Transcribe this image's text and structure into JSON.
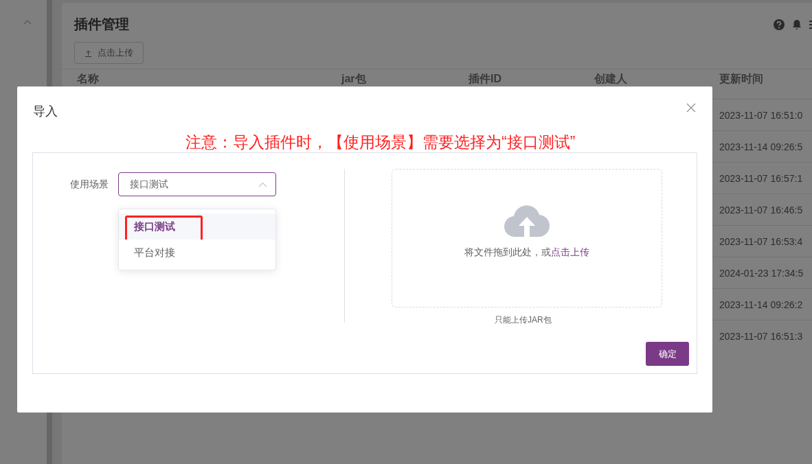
{
  "page": {
    "title": "插件管理",
    "upload_button": "点击上传"
  },
  "table": {
    "columns": [
      "名称",
      "jar包",
      "插件ID",
      "创建人",
      "更新时间"
    ],
    "rows": [
      {
        "updated": "2023-11-07 16:51:0"
      },
      {
        "updated": "2023-11-14 09:26:5"
      },
      {
        "updated": "2023-11-07 16:57:1"
      },
      {
        "updated": "2023-11-07 16:46:5"
      },
      {
        "updated": "2023-11-07 16:53:4"
      },
      {
        "updated": "2024-01-23 17:34:5"
      },
      {
        "updated": "2023-11-14 09:26:2"
      },
      {
        "updated": "2023-11-07 16:51:3"
      }
    ]
  },
  "dialog": {
    "title": "导入",
    "annotation": "注意：导入插件时，【使用场景】需要选择为“接口测试”",
    "field_label": "使用场景",
    "select": {
      "value": "接口测试",
      "expanded": true
    },
    "options": [
      {
        "label": "接口测试",
        "selected": true,
        "highlighted": true
      },
      {
        "label": "平台对接",
        "selected": false,
        "highlighted": false
      }
    ],
    "upload": {
      "drop_text": "将文件拖到此处，或",
      "link_text": "点击上传",
      "hint": "只能上传JAR包"
    },
    "confirm_button": "确定"
  }
}
